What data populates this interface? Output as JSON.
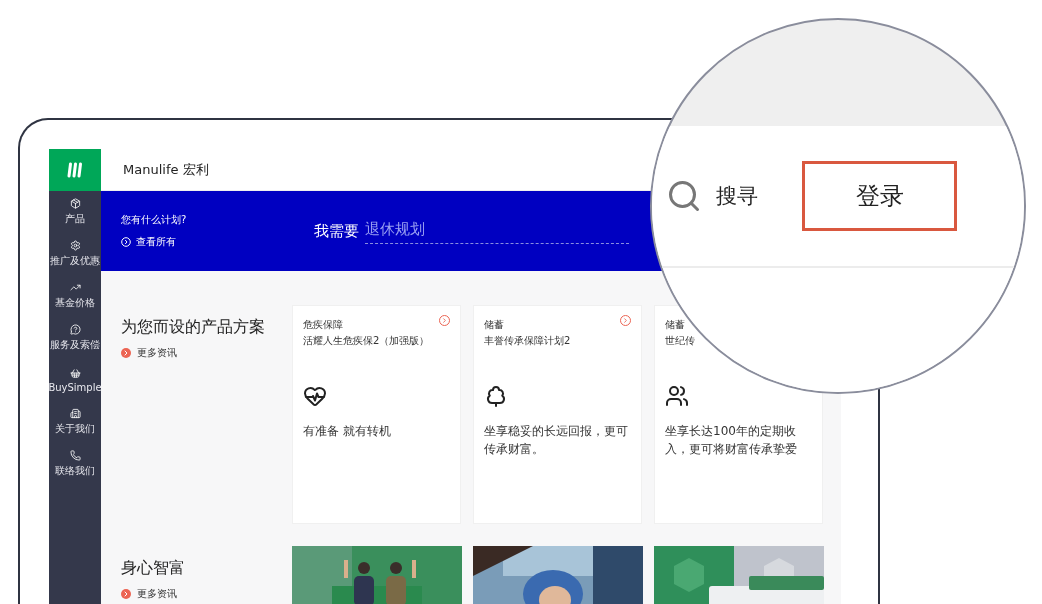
{
  "header": {
    "brand": "Manulife 宏利"
  },
  "sidebar": {
    "items": [
      {
        "label": "产品"
      },
      {
        "label": "推广及优惠"
      },
      {
        "label": "基金价格"
      },
      {
        "label": "服务及索偿"
      },
      {
        "label": "BuySimple"
      },
      {
        "label": "关于我们"
      },
      {
        "label": "联络我们"
      }
    ]
  },
  "banner": {
    "question": "您有什么计划?",
    "link": "查看所有",
    "prompt": "我需要",
    "value": "退休规划"
  },
  "products": {
    "title": "为您而设的产品方案",
    "link": "更多资讯",
    "cards": [
      {
        "category": "危疾保障",
        "title": "活耀人生危疾保2（加强版）",
        "description": "有准备 就有转机"
      },
      {
        "category": "储蓄",
        "title": "丰誉传承保障计划2",
        "description": "坐享稳妥的长远回报，更可传承财富。"
      },
      {
        "category": "储蓄",
        "title": "世纪传",
        "description": "坐享长达100年的定期收入，更可将财富传承挚爱"
      }
    ]
  },
  "wellness": {
    "title": "身心智富",
    "link": "更多资讯"
  },
  "magnifier": {
    "search": "搜寻",
    "login": "登录"
  }
}
